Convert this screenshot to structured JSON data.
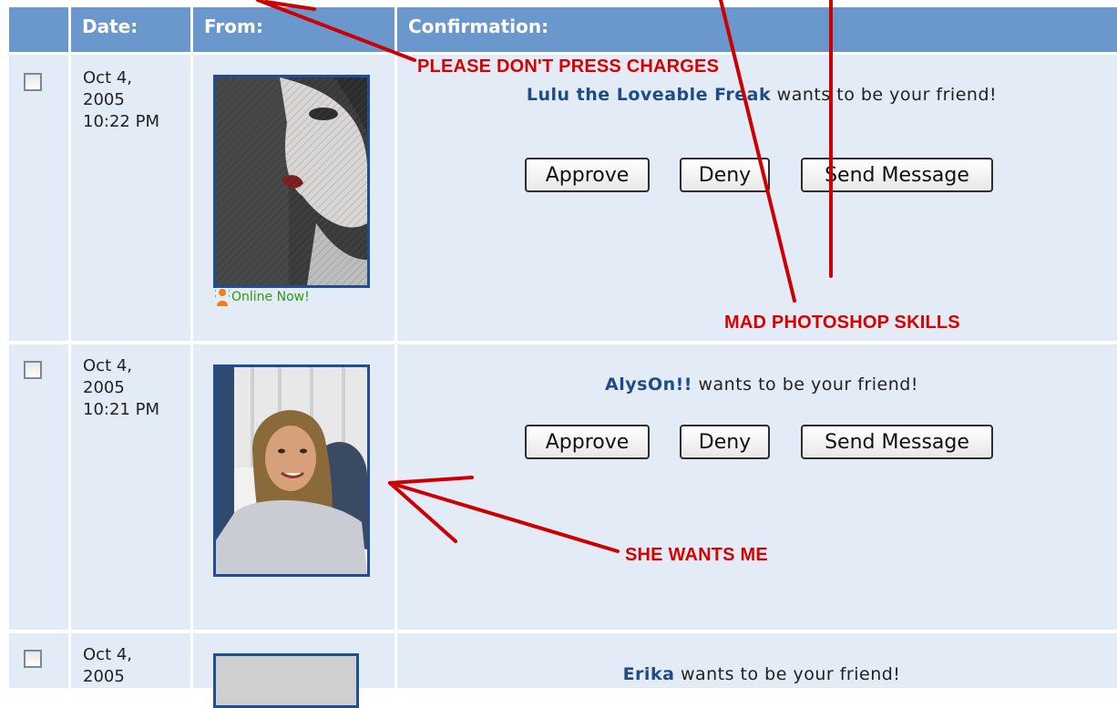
{
  "table": {
    "headers": {
      "date": "Date:",
      "from": "From:",
      "confirmation": "Confirmation:"
    },
    "rows": [
      {
        "date_line1": "Oct 4,",
        "date_line2": "2005",
        "date_line3": "10:22 PM",
        "name": "Lulu the Loveable Freak",
        "message_suffix": " wants to be your friend!",
        "online_label": "Online Now!",
        "approve": "Approve",
        "deny": "Deny",
        "send_message": "Send Message"
      },
      {
        "date_line1": "Oct 4,",
        "date_line2": "2005",
        "date_line3": "10:21 PM",
        "name": "AlysOn!!",
        "message_suffix": " wants to be your friend!",
        "approve": "Approve",
        "deny": "Deny",
        "send_message": "Send Message"
      },
      {
        "date_line1": "Oct 4,",
        "date_line2": "2005",
        "name": "Erika",
        "message_suffix": " wants to be your friend!"
      }
    ]
  },
  "annotations": {
    "charges": "PLEASE DON'T PRESS CHARGES",
    "photoshop": "MAD PHOTOSHOP SKILLS",
    "wants": "SHE WANTS ME"
  },
  "colors": {
    "header_bg": "#6a98cd",
    "row_bg": "#e3ebf6",
    "name_link": "#1e4c86",
    "annotation": "#d90000",
    "online": "#2c9a12"
  }
}
